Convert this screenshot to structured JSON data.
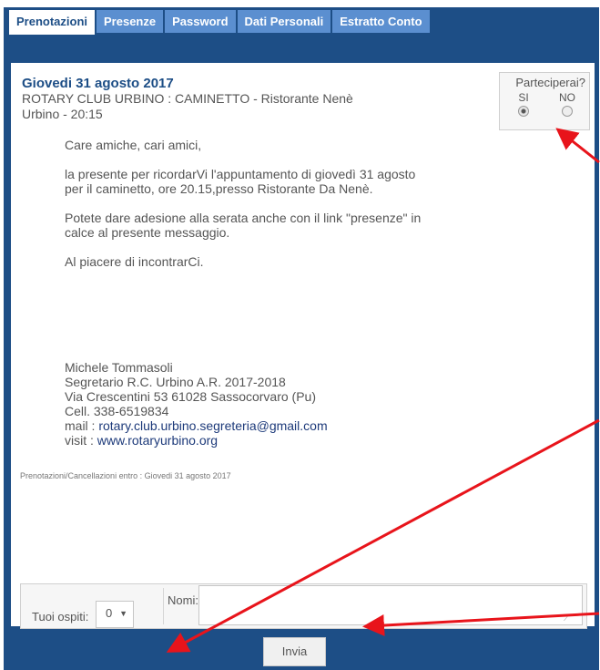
{
  "tabs": [
    {
      "label": "Prenotazioni"
    },
    {
      "label": "Presenze"
    },
    {
      "label": "Password"
    },
    {
      "label": "Dati Personali"
    },
    {
      "label": "Estratto Conto"
    }
  ],
  "event": {
    "title": "Giovedi 31 agosto 2017",
    "organization": "ROTARY CLUB URBINO : CAMINETTO - Ristorante Nenè",
    "location_time": "Urbino - 20:15"
  },
  "rsvp": {
    "question": "Parteciperai?",
    "yes_label": "SI",
    "no_label": "NO",
    "selected": "SI"
  },
  "message": {
    "greeting": "Care amiche, cari amici,",
    "paragraph1": "la presente per ricordarVi l'appuntamento di giovedì 31 agosto per il caminetto, ore 20.15,presso Ristorante Da Nenè.",
    "paragraph2": "Potete dare adesione alla serata anche con il link \"presenze\" in calce al presente messaggio.",
    "closing": "Al piacere di incontrarCi."
  },
  "signature": {
    "name": "Michele Tommasoli",
    "role": "Segretario R.C. Urbino A.R. 2017-2018",
    "address": "Via Crescentini 53 61028 Sassocorvaro (Pu)",
    "phone": "Cell. 338-6519834",
    "mail_label": "mail  :",
    "email": "rotary.club.urbino.segreteria@gmail.com",
    "visit_label": "visit :",
    "website": "www.rotaryurbino.org"
  },
  "deadline": "Prenotazioni/Cancellazioni entro : Giovedi 31 agosto 2017",
  "guests": {
    "label": "Tuoi ospiti:",
    "count": "0",
    "names_label": "Nomi:",
    "names_value": ""
  },
  "submit_label": "Invia",
  "colors": {
    "header": "#1d4e86",
    "tab": "#5b8fd0",
    "arrow": "#e8141b"
  }
}
